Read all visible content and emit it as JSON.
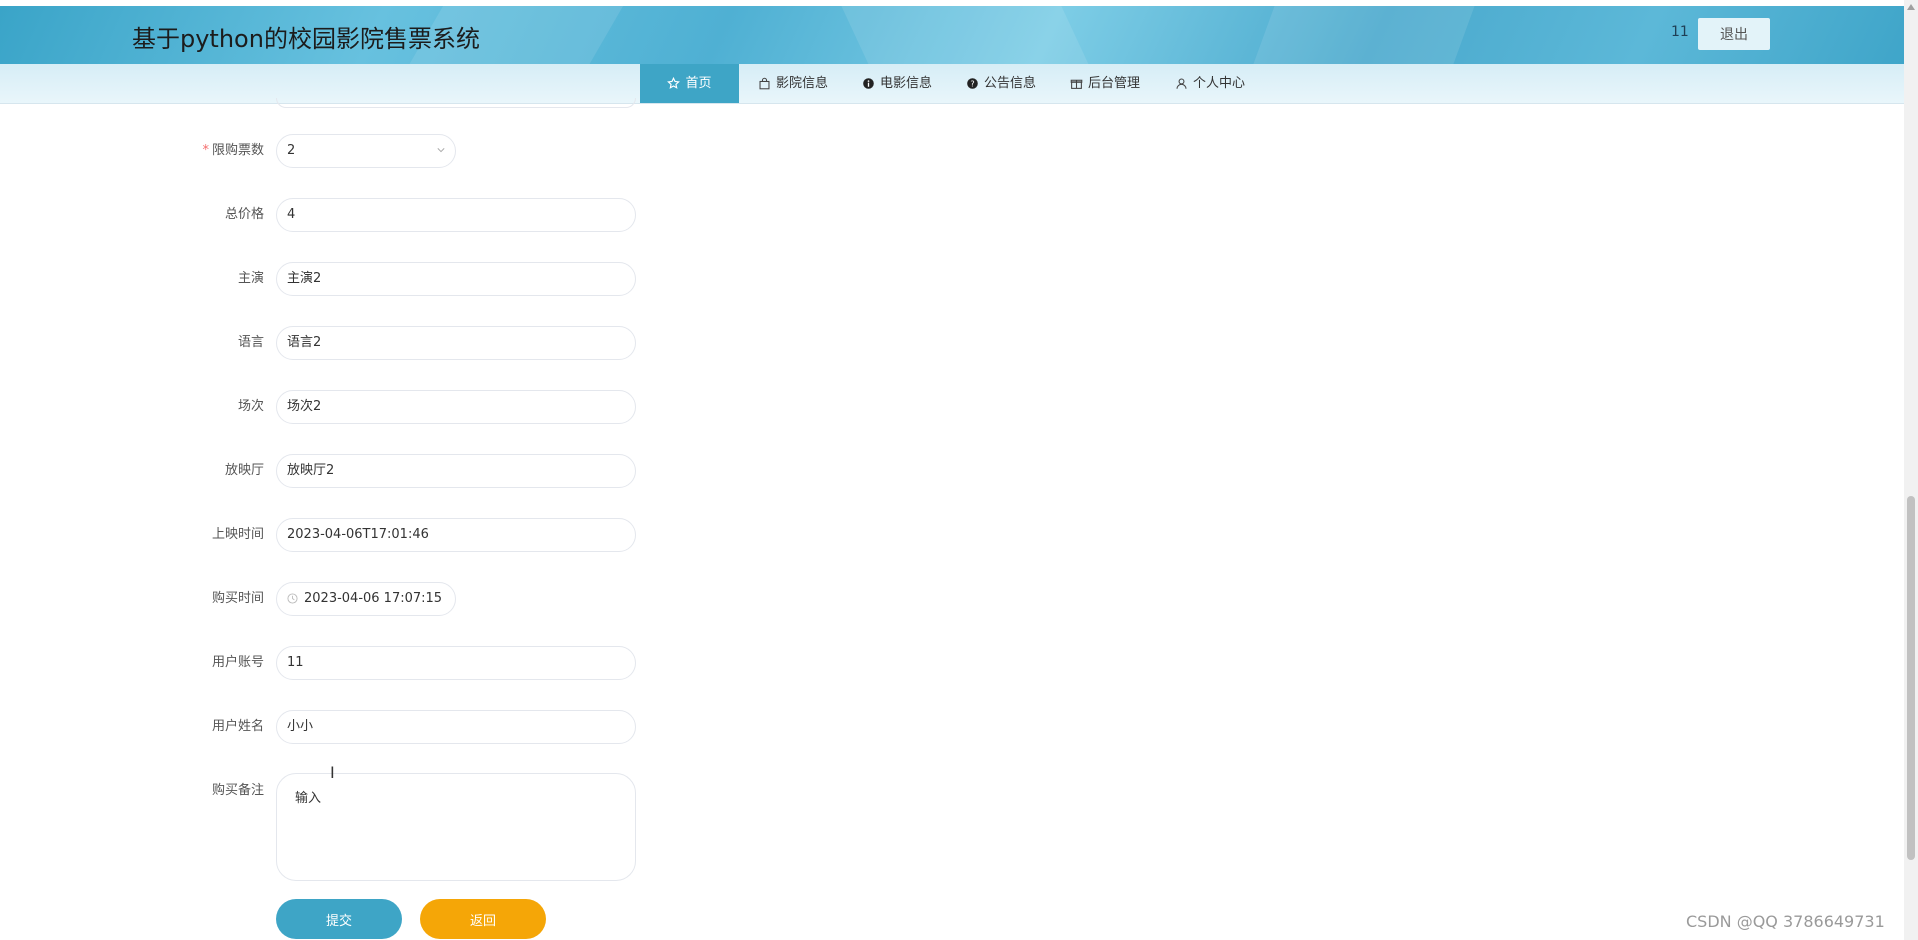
{
  "header": {
    "title": "基于python的校园影院售票系统",
    "user": "11",
    "logout": "退出"
  },
  "nav": [
    {
      "label": "首页",
      "icon": "star-icon",
      "active": true
    },
    {
      "label": "影院信息",
      "icon": "bag-icon",
      "active": false
    },
    {
      "label": "电影信息",
      "icon": "info-icon",
      "active": false
    },
    {
      "label": "公告信息",
      "icon": "question-icon",
      "active": false
    },
    {
      "label": "后台管理",
      "icon": "gift-icon",
      "active": false
    },
    {
      "label": "个人中心",
      "icon": "user-icon",
      "active": false
    }
  ],
  "form": {
    "purchase_limit": {
      "label": "限购票数",
      "value": "2",
      "required": true
    },
    "total_price": {
      "label": "总价格",
      "value": "4"
    },
    "lead_actor": {
      "label": "主演",
      "value": "主演2"
    },
    "language": {
      "label": "语言",
      "value": "语言2"
    },
    "session": {
      "label": "场次",
      "value": "场次2"
    },
    "hall": {
      "label": "放映厅",
      "value": "放映厅2"
    },
    "show_time": {
      "label": "上映时间",
      "value": "2023-04-06T17:01:46"
    },
    "purchase_time": {
      "label": "购买时间",
      "value": "2023-04-06 17:07:15"
    },
    "user_account": {
      "label": "用户账号",
      "value": "11"
    },
    "user_name": {
      "label": "用户姓名",
      "value": "小小"
    },
    "remark": {
      "label": "购买备注",
      "value": "输入"
    },
    "submit": "提交",
    "back": "返回"
  },
  "watermark": "CSDN @QQ 3786649731",
  "colors": {
    "primary": "#3ea5c6",
    "warning": "#f5a607",
    "required": "#f56c6c"
  }
}
